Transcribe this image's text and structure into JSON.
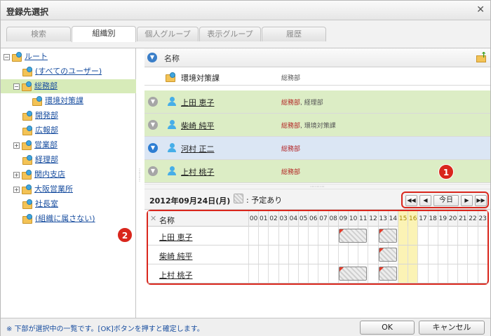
{
  "window": {
    "title": "登録先選択"
  },
  "tabs": [
    {
      "label": "検索"
    },
    {
      "label": "組織別"
    },
    {
      "label": "個人グループ"
    },
    {
      "label": "表示グループ"
    },
    {
      "label": "履歴"
    }
  ],
  "active_tab": "組織別",
  "tree": [
    {
      "label": "ルート",
      "toggle": "−"
    },
    {
      "label": "(すべてのユーザー)",
      "toggle": ""
    },
    {
      "label": "総務部",
      "toggle": "−",
      "selected": true
    },
    {
      "label": "環境対策課",
      "toggle": ""
    },
    {
      "label": "開発部",
      "toggle": ""
    },
    {
      "label": "広報部",
      "toggle": ""
    },
    {
      "label": "営業部",
      "toggle": "+"
    },
    {
      "label": "経理部",
      "toggle": ""
    },
    {
      "label": "関内支店",
      "toggle": "+"
    },
    {
      "label": "大阪営業所",
      "toggle": "+"
    },
    {
      "label": "社長室",
      "toggle": ""
    },
    {
      "label": "(組織に属さない)",
      "toggle": ""
    }
  ],
  "list": {
    "header": "名称",
    "rows": [
      {
        "name": "環境対策課",
        "type": "org",
        "org_primary": "",
        "org_rest": "総務部"
      },
      {
        "name": "上田 恵子",
        "type": "user",
        "org_primary": "総務部",
        "org_rest": ", 経理部"
      },
      {
        "name": "柴崎 純平",
        "type": "user",
        "org_primary": "総務部",
        "org_rest": ", 環境対策課"
      },
      {
        "name": "河村 正二",
        "type": "user",
        "org_primary": "総務部",
        "org_rest": ""
      },
      {
        "name": "上村 桃子",
        "type": "user",
        "org_primary": "総務部",
        "org_rest": ""
      }
    ]
  },
  "schedule": {
    "date": "2012年09月24日(月)",
    "legend": ": 予定あり",
    "nav": {
      "first": "◀◀",
      "prev": "◀",
      "today": "今日",
      "next": "▶",
      "last": "▶▶"
    },
    "header_name": "名称",
    "hours": [
      "00",
      "01",
      "02",
      "03",
      "04",
      "05",
      "06",
      "07",
      "08",
      "09",
      "10",
      "11",
      "12",
      "13",
      "14",
      "15",
      "16",
      "17",
      "18",
      "19",
      "20",
      "21",
      "22",
      "23"
    ],
    "current_hours": [
      "15",
      "16"
    ],
    "people": [
      {
        "name": "上田 恵子",
        "events": [
          [
            9,
            11
          ],
          [
            13,
            14
          ]
        ]
      },
      {
        "name": "柴崎 純平",
        "events": [
          [
            13,
            14
          ]
        ]
      },
      {
        "name": "上村 桃子",
        "events": [
          [
            9,
            11
          ],
          [
            13,
            14
          ]
        ]
      }
    ]
  },
  "annotations": [
    "1",
    "2"
  ],
  "footer": {
    "note": "※ 下部が選択中の一覧です。[OK]ボタンを押すと確定します。",
    "ok": "OK",
    "cancel": "キャンセル"
  },
  "colors": {
    "selected_green": "#d7ebb9",
    "selected_blue": "#dbe6f4",
    "annotation_red": "#d9261c",
    "now_yellow": "#fbf3b5"
  }
}
